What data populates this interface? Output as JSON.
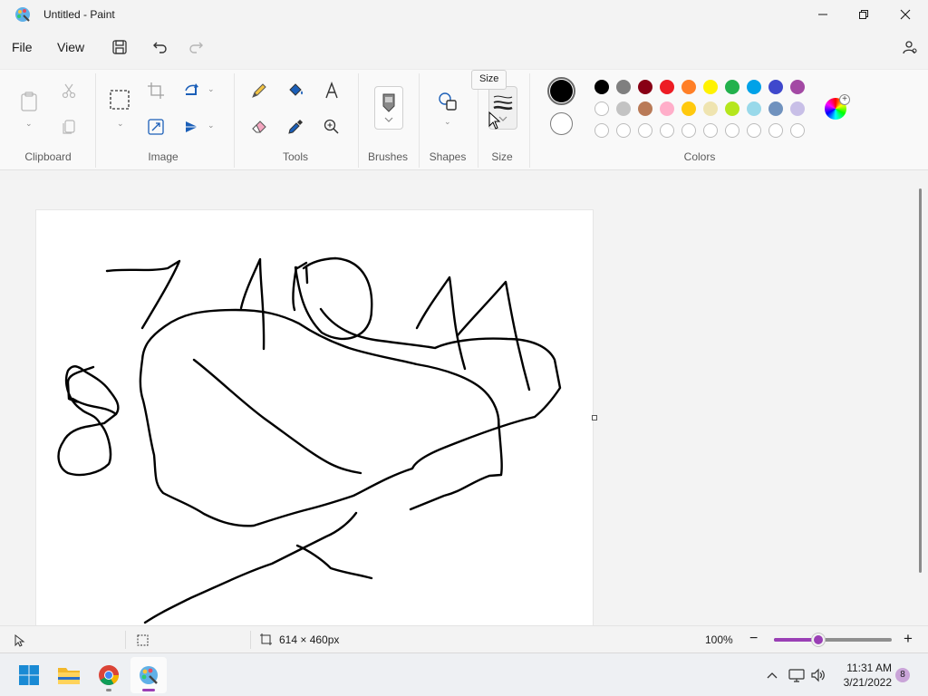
{
  "window": {
    "title": "Untitled - Paint"
  },
  "menu": {
    "file": "File",
    "view": "View"
  },
  "ribbon": {
    "groups": {
      "clipboard": "Clipboard",
      "image": "Image",
      "tools": "Tools",
      "brushes": "Brushes",
      "shapes": "Shapes",
      "size": "Size",
      "colors": "Colors"
    },
    "tooltip": "Size",
    "primary_color": "#000000",
    "secondary_color": "#ffffff",
    "palette_row1": [
      "#000000",
      "#7f7f7f",
      "#880015",
      "#ed1c24",
      "#ff7f27",
      "#fff200",
      "#22b14c",
      "#00a2e8",
      "#3f48cc",
      "#a349a4"
    ],
    "palette_row2": [
      "#ffffff",
      "#c3c3c3",
      "#b97a57",
      "#ffaec9",
      "#ffc90e",
      "#efe4b0",
      "#b5e61d",
      "#99d9ea",
      "#7092be",
      "#c8bfe7"
    ],
    "palette_row3_empty_count": 10
  },
  "status": {
    "canvas_size": "614 × 460px",
    "zoom": "100%",
    "zoom_fraction": 0.38
  },
  "taskbar": {
    "time": "11:31 AM",
    "date": "3/21/2022",
    "notifications": "8",
    "apps": [
      "start-icon",
      "file-explorer-icon",
      "chrome-icon",
      "paint-icon"
    ]
  }
}
